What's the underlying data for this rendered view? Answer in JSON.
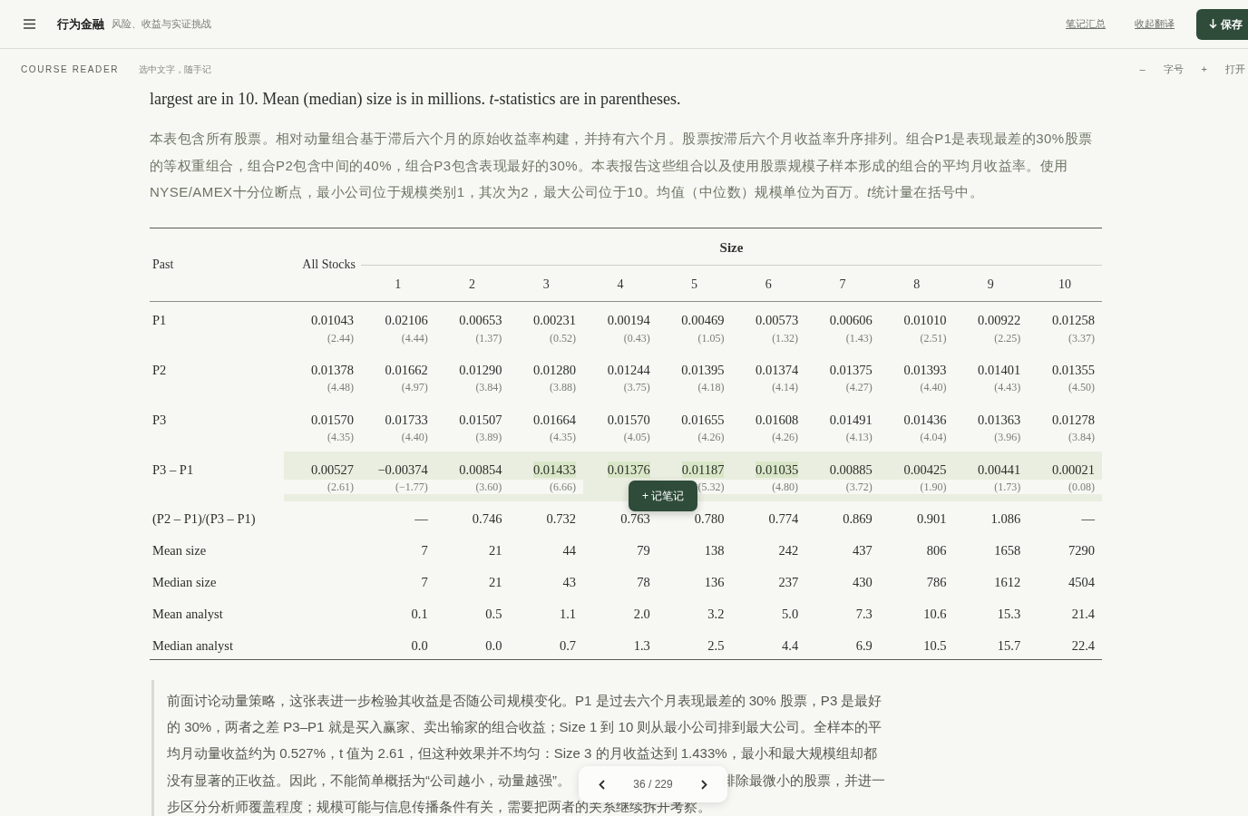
{
  "app_bar": {
    "title": "行为金融",
    "subtitle": "风险、收益与实证挑战",
    "links": [
      "笔记汇总",
      "收起翻译"
    ],
    "save_button": "保存"
  },
  "reader_bar": {
    "label": "COURSE READER",
    "hint": "选中文字，随手记",
    "controls": [
      {
        "kind": "minus",
        "text": "–"
      },
      {
        "kind": "label",
        "text": "字号"
      },
      {
        "kind": "plus",
        "text": "+"
      },
      {
        "kind": "open",
        "text": "打开"
      }
    ]
  },
  "caption_en": "largest are in 10. Mean (median) size is in millions. *t*-statistics are in parentheses.",
  "caption_zh": [
    {
      "text": "本表包含所有股票。相对动量组合基于滞后六个月的原始收益率构建，并持有六个月。股票按滞后六个月收益率升序排列。组合P1是表现最差的30%股票的等权重组合，组合P2包含中间的40%，组合P3包含表现最好的30%。本表报告这些组合以及使用股票规模子样本形成的组合的平均月收益率。使用NYSE/AMEX十分位断点，最小公司位于规模类别1，其次为2，最大公司位于10。均值（中位数）规模单位为百万。",
      "italic": false
    },
    {
      "text": "t",
      "italic": true
    },
    {
      "text": "统计量在括号中。",
      "italic": false
    }
  ],
  "table": {
    "header": {
      "past": "Past",
      "all": "All Stocks",
      "group": "Size",
      "sizes": [
        "1",
        "2",
        "3",
        "4",
        "5",
        "6",
        "7",
        "8",
        "9",
        "10"
      ]
    },
    "rows": [
      {
        "label": "P1",
        "kind": "return",
        "shaded": false,
        "cells": [
          {
            "value": "0.01043",
            "tstat": "(2.44)",
            "highlighted": false
          },
          {
            "value": "0.02106",
            "tstat": "(4.44)",
            "highlighted": false
          },
          {
            "value": "0.00653",
            "tstat": "(1.37)",
            "highlighted": false
          },
          {
            "value": "0.00231",
            "tstat": "(0.52)",
            "highlighted": false
          },
          {
            "value": "0.00194",
            "tstat": "(0.43)",
            "highlighted": false
          },
          {
            "value": "0.00469",
            "tstat": "(1.05)",
            "highlighted": false
          },
          {
            "value": "0.00573",
            "tstat": "(1.32)",
            "highlighted": false
          },
          {
            "value": "0.00606",
            "tstat": "(1.43)",
            "highlighted": false
          },
          {
            "value": "0.01010",
            "tstat": "(2.51)",
            "highlighted": false
          },
          {
            "value": "0.00922",
            "tstat": "(2.25)",
            "highlighted": false
          },
          {
            "value": "0.01258",
            "tstat": "(3.37)",
            "highlighted": false
          }
        ]
      },
      {
        "label": "P2",
        "kind": "return",
        "shaded": false,
        "cells": [
          {
            "value": "0.01378",
            "tstat": "(4.48)",
            "highlighted": false
          },
          {
            "value": "0.01662",
            "tstat": "(4.97)",
            "highlighted": false
          },
          {
            "value": "0.01290",
            "tstat": "(3.84)",
            "highlighted": false
          },
          {
            "value": "0.01280",
            "tstat": "(3.88)",
            "highlighted": false
          },
          {
            "value": "0.01244",
            "tstat": "(3.75)",
            "highlighted": false
          },
          {
            "value": "0.01395",
            "tstat": "(4.18)",
            "highlighted": false
          },
          {
            "value": "0.01374",
            "tstat": "(4.14)",
            "highlighted": false
          },
          {
            "value": "0.01375",
            "tstat": "(4.27)",
            "highlighted": false
          },
          {
            "value": "0.01393",
            "tstat": "(4.40)",
            "highlighted": false
          },
          {
            "value": "0.01401",
            "tstat": "(4.43)",
            "highlighted": false
          },
          {
            "value": "0.01355",
            "tstat": "(4.50)",
            "highlighted": false
          }
        ]
      },
      {
        "label": "P3",
        "kind": "return",
        "shaded": false,
        "cells": [
          {
            "value": "0.01570",
            "tstat": "(4.35)",
            "highlighted": false
          },
          {
            "value": "0.01733",
            "tstat": "(4.40)",
            "highlighted": false
          },
          {
            "value": "0.01507",
            "tstat": "(3.89)",
            "highlighted": false
          },
          {
            "value": "0.01664",
            "tstat": "(4.35)",
            "highlighted": false
          },
          {
            "value": "0.01570",
            "tstat": "(4.05)",
            "highlighted": false
          },
          {
            "value": "0.01655",
            "tstat": "(4.26)",
            "highlighted": false
          },
          {
            "value": "0.01608",
            "tstat": "(4.26)",
            "highlighted": false
          },
          {
            "value": "0.01491",
            "tstat": "(4.13)",
            "highlighted": false
          },
          {
            "value": "0.01436",
            "tstat": "(4.04)",
            "highlighted": false
          },
          {
            "value": "0.01363",
            "tstat": "(3.96)",
            "highlighted": false
          },
          {
            "value": "0.01278",
            "tstat": "(3.84)",
            "highlighted": false
          }
        ]
      },
      {
        "label": "P3 – P1",
        "kind": "return",
        "shaded": true,
        "cells": [
          {
            "value": "0.00527",
            "tstat": "(2.61)",
            "highlighted": false
          },
          {
            "value": "−0.00374",
            "tstat": "(−1.77)",
            "highlighted": false
          },
          {
            "value": "0.00854",
            "tstat": "(3.60)",
            "highlighted": false
          },
          {
            "value": "0.01433",
            "tstat": "(6.66)",
            "highlighted": true
          },
          {
            "value": "0.01376",
            "highlighted": true
          },
          {
            "value": "0.01187",
            "tstat": "(5.32)",
            "highlighted": true
          },
          {
            "value": "0.01035",
            "tstat": "(4.80)",
            "highlighted": true
          },
          {
            "value": "0.00885",
            "tstat": "(3.72)",
            "highlighted": false
          },
          {
            "value": "0.00425",
            "tstat": "(1.90)",
            "highlighted": false
          },
          {
            "value": "0.00441",
            "tstat": "(1.73)",
            "highlighted": false
          },
          {
            "value": "0.00021",
            "tstat": "(0.08)",
            "highlighted": false
          }
        ]
      },
      {
        "label": "(P2 – P1)/(P3 – P1)",
        "kind": "stat",
        "shaded": false,
        "cells": [
          null,
          {
            "value": "—"
          },
          {
            "value": "0.746"
          },
          {
            "value": "0.732"
          },
          {
            "value": "0.763"
          },
          {
            "value": "0.780"
          },
          {
            "value": "0.774"
          },
          {
            "value": "0.869"
          },
          {
            "value": "0.901"
          },
          {
            "value": "1.086"
          },
          {
            "value": "—"
          }
        ]
      },
      {
        "label": "Mean size",
        "kind": "stat",
        "shaded": false,
        "cells": [
          null,
          {
            "value": "7"
          },
          {
            "value": "21"
          },
          {
            "value": "44"
          },
          {
            "value": "79"
          },
          {
            "value": "138"
          },
          {
            "value": "242"
          },
          {
            "value": "437"
          },
          {
            "value": "806"
          },
          {
            "value": "1658"
          },
          {
            "value": "7290"
          }
        ]
      },
      {
        "label": "Median size",
        "kind": "stat",
        "shaded": false,
        "cells": [
          null,
          {
            "value": "7"
          },
          {
            "value": "21"
          },
          {
            "value": "43"
          },
          {
            "value": "78"
          },
          {
            "value": "136"
          },
          {
            "value": "237"
          },
          {
            "value": "430"
          },
          {
            "value": "786"
          },
          {
            "value": "1612"
          },
          {
            "value": "4504"
          }
        ]
      },
      {
        "label": "Mean analyst",
        "kind": "stat",
        "shaded": false,
        "cells": [
          null,
          {
            "value": "0.1"
          },
          {
            "value": "0.5"
          },
          {
            "value": "1.1"
          },
          {
            "value": "2.0"
          },
          {
            "value": "3.2"
          },
          {
            "value": "5.0"
          },
          {
            "value": "7.3"
          },
          {
            "value": "10.6"
          },
          {
            "value": "15.3"
          },
          {
            "value": "21.4"
          }
        ]
      },
      {
        "label": "Median analyst",
        "kind": "stat",
        "shaded": false,
        "cells": [
          null,
          {
            "value": "0.0"
          },
          {
            "value": "0.0"
          },
          {
            "value": "0.7"
          },
          {
            "value": "1.3"
          },
          {
            "value": "2.5"
          },
          {
            "value": "4.4"
          },
          {
            "value": "6.9"
          },
          {
            "value": "10.5"
          },
          {
            "value": "15.7"
          },
          {
            "value": "22.4"
          }
        ]
      }
    ]
  },
  "note_popup": {
    "label": "+ 记笔记"
  },
  "note": {
    "lines": [
      {
        "parts": [
          "前面讨论动量策略，这张表进一步检验其收益是否随公司规模变化。P1 是过去六个月表现最差的 30% 股票，P3 是最好"
        ]
      },
      {
        "parts": [
          "的 30%，两者之差 P3–P1 就是买入赢家、卖出输家的组合收益；Size 1 到 10 则从最小公司排到最大公司。全样本的平"
        ]
      },
      {
        "parts": [
          "均月动量收益约为 0.527%，t 值为 2.61，但这种效果并不均匀：Size 3 的月收益达到 1.433%，最小和最大规模组却都"
        ]
      },
      {
        "parts": [
          "没有显著的正收益。因此，不能简单概括为“公司越小，动量越强”。",
          "排除最微小的股票，并进一"
        ]
      },
      {
        "parts": [
          "步区分分析师覆盖程度；规模可能与信息传播条件有关，需要把两者的关系继续拆开考察。"
        ]
      }
    ]
  },
  "pager": {
    "page": "36 / 229"
  }
}
